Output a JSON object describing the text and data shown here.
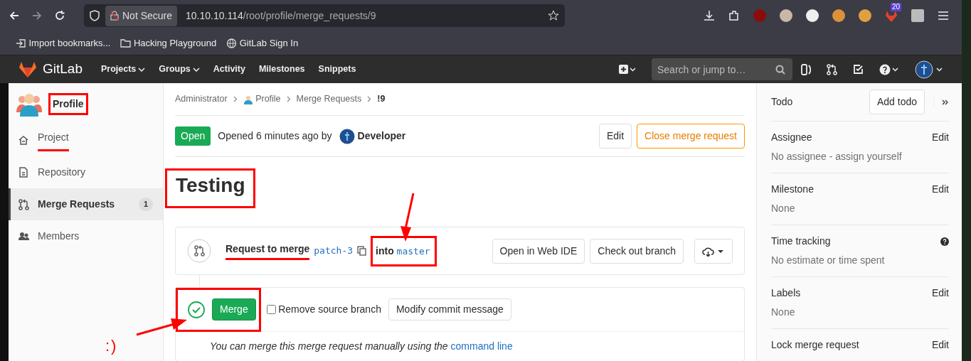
{
  "browser": {
    "security_label": "Not Secure",
    "url_host": "10.10.10.114",
    "url_path": "/root/profile/merge_requests/9",
    "extension_badge": "20",
    "bookmarks": [
      "Import bookmarks...",
      "Hacking Playground",
      "GitLab Sign In"
    ]
  },
  "gitlab_nav": {
    "brand": "GitLab",
    "menu": [
      {
        "label": "Projects",
        "dropdown": true
      },
      {
        "label": "Groups",
        "dropdown": true
      },
      {
        "label": "Activity",
        "dropdown": false
      },
      {
        "label": "Milestones",
        "dropdown": false
      },
      {
        "label": "Snippets",
        "dropdown": false
      }
    ],
    "search": {
      "placeholder": "Search or jump to…"
    }
  },
  "sidebar": {
    "title": "Profile",
    "title_boxed": true,
    "items": [
      {
        "label": "Project",
        "selected": false,
        "underlined": true
      },
      {
        "label": "Repository",
        "selected": false,
        "underlined": false
      },
      {
        "label": "Merge Requests",
        "selected": true,
        "underlined": false,
        "count": "1"
      },
      {
        "label": "Members",
        "selected": false,
        "underlined": false
      }
    ]
  },
  "breadcrumb": [
    {
      "label": "Administrator",
      "avatar": false,
      "current": false
    },
    {
      "label": "Profile",
      "avatar": true,
      "current": false
    },
    {
      "label": "Merge Requests",
      "avatar": false,
      "current": false
    },
    {
      "label": "!9",
      "avatar": false,
      "current": true
    }
  ],
  "header": {
    "status": "Open",
    "opened_text": "Opened 6 minutes ago by",
    "author": "Developer",
    "buttons": [
      {
        "label": "Edit",
        "kind": "default"
      },
      {
        "label": "Close merge request",
        "kind": "warning"
      }
    ]
  },
  "title": {
    "text": "Testing",
    "boxed": true
  },
  "merge_bar": {
    "label": "Request to merge",
    "label_underlined": true,
    "source": "patch-3",
    "into": "into",
    "target": "master",
    "target_boxed": true,
    "buttons": [
      "Open in Web IDE",
      "Check out branch"
    ]
  },
  "merge_widget": {
    "boxed": true,
    "merge_button": "Merge",
    "remove_source": {
      "label": "Remove source branch",
      "checked": false
    },
    "modify_button": "Modify commit message",
    "help_text": "You can merge this merge request manually using the",
    "help_link": "command line"
  },
  "right_sidebar": {
    "todo": {
      "label": "Todo",
      "button": "Add todo"
    },
    "blocks": [
      {
        "kind": "edit",
        "label": "Assignee",
        "action": "Edit",
        "value": "No assignee - assign yourself"
      },
      {
        "kind": "edit",
        "label": "Milestone",
        "action": "Edit",
        "value": "None"
      },
      {
        "kind": "help",
        "label": "Time tracking",
        "value": "No estimate or time spent"
      },
      {
        "kind": "edit",
        "label": "Labels",
        "action": "Edit",
        "value": "None"
      },
      {
        "kind": "edit",
        "label": "Lock merge request",
        "action": "Edit"
      }
    ]
  },
  "annotation": {
    "note": ":)"
  }
}
